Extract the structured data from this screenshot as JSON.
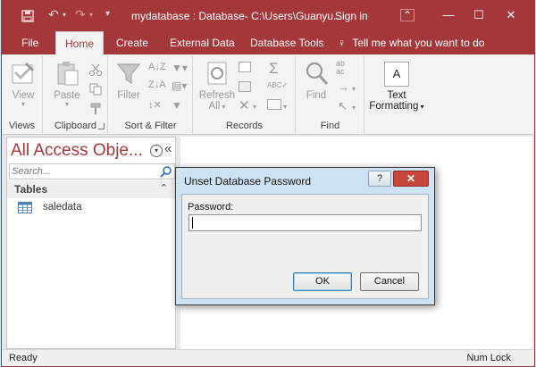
{
  "titlebar": {
    "title": "mydatabase : Database- C:\\Users\\Guanyu...",
    "signin": "Sign in",
    "help_glyph": "?",
    "minimize_glyph": "—",
    "restore_glyph": "☐",
    "close_glyph": "✕"
  },
  "ribbon": {
    "tabs": [
      {
        "label": "File"
      },
      {
        "label": "Home"
      },
      {
        "label": "Create"
      },
      {
        "label": "External Data"
      },
      {
        "label": "Database Tools"
      }
    ],
    "tell_me": "Tell me what you want to do",
    "groups": {
      "views": {
        "label": "Views",
        "view": "View"
      },
      "clipboard": {
        "label": "Clipboard",
        "paste": "Paste"
      },
      "sort_filter": {
        "label": "Sort & Filter",
        "filter": "Filter"
      },
      "records": {
        "label": "Records",
        "refresh": "Refresh",
        "all": "All"
      },
      "find": {
        "label": "Find",
        "find": "Find"
      },
      "text_formatting": {
        "text": "Text",
        "formatting": "Formatting",
        "icon_letter": "A"
      }
    }
  },
  "nav": {
    "title": "All Access Obje...",
    "collapse_glyph": "«",
    "search_placeholder": "Search...",
    "section": "Tables",
    "section_glyph": "⌃",
    "items": [
      {
        "label": "saledata"
      }
    ]
  },
  "dialog": {
    "title": "Unset Database Password",
    "help_glyph": "?",
    "close_glyph": "✕",
    "password_label": "Password:",
    "password_value": "",
    "ok": "OK",
    "cancel": "Cancel"
  },
  "status": {
    "left": "Ready",
    "right": "Num Lock"
  },
  "colors": {
    "accent": "#a4373a",
    "dialog_frame": "#cde3f3"
  }
}
